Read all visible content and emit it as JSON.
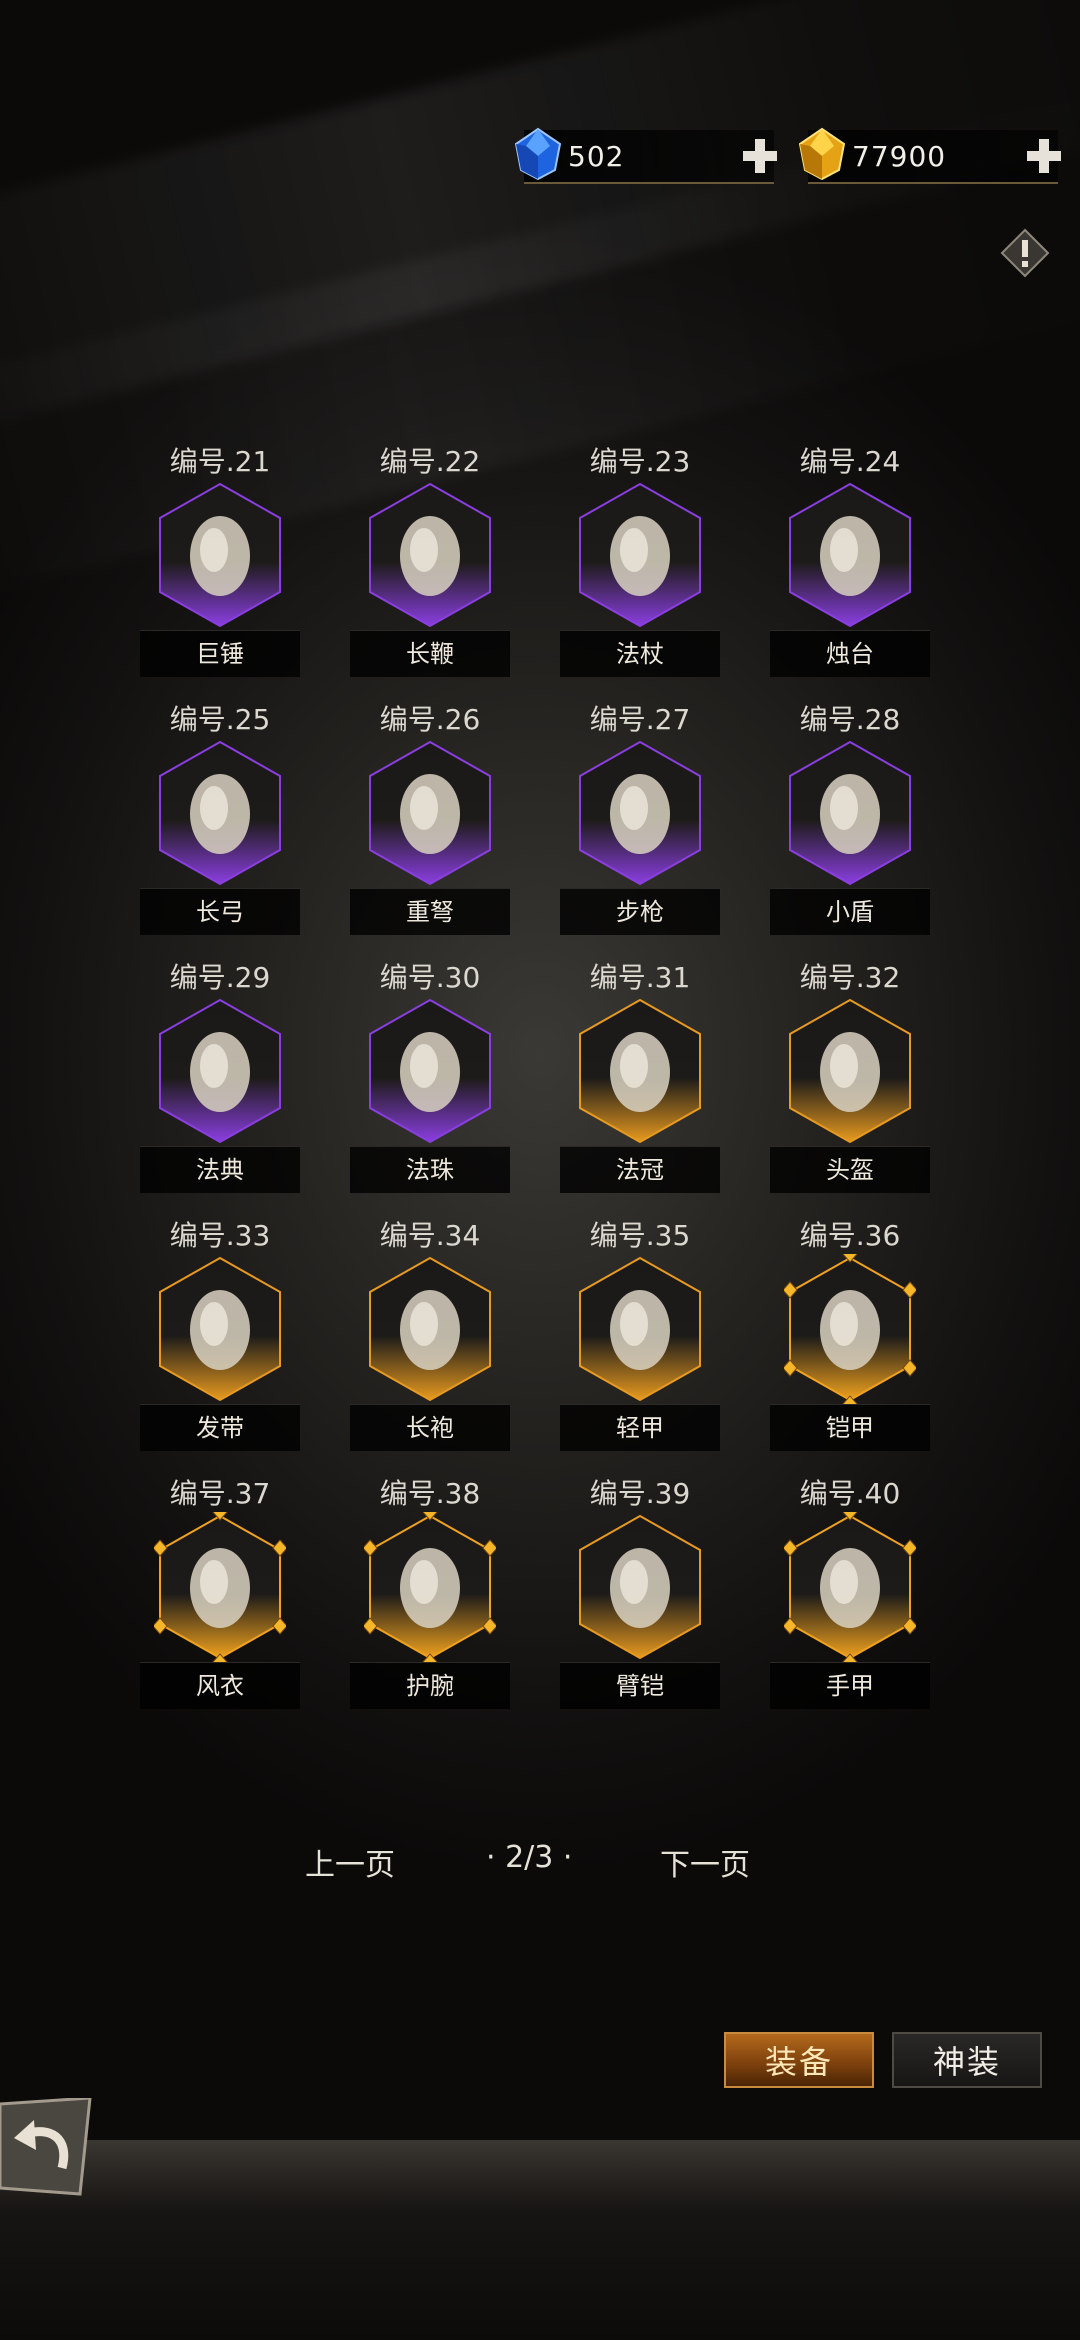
{
  "currencies": [
    {
      "name": "diamond",
      "icon": "blue-gem-icon",
      "amount": "502",
      "color": "#2f7fff"
    },
    {
      "name": "gold",
      "icon": "gold-gem-icon",
      "amount": "77900",
      "color": "#f2b51c"
    }
  ],
  "items": [
    {
      "num": "编号.21",
      "name": "巨锤",
      "icon": "warhammer-icon",
      "rarity": "epic"
    },
    {
      "num": "编号.22",
      "name": "长鞭",
      "icon": "whip-icon",
      "rarity": "epic"
    },
    {
      "num": "编号.23",
      "name": "法杖",
      "icon": "staff-icon",
      "rarity": "epic"
    },
    {
      "num": "编号.24",
      "name": "烛台",
      "icon": "candlestick-icon",
      "rarity": "epic"
    },
    {
      "num": "编号.25",
      "name": "长弓",
      "icon": "longbow-icon",
      "rarity": "epic"
    },
    {
      "num": "编号.26",
      "name": "重弩",
      "icon": "crossbow-icon",
      "rarity": "epic"
    },
    {
      "num": "编号.27",
      "name": "步枪",
      "icon": "rifle-icon",
      "rarity": "epic"
    },
    {
      "num": "编号.28",
      "name": "小盾",
      "icon": "small-shield-icon",
      "rarity": "epic"
    },
    {
      "num": "编号.29",
      "name": "法典",
      "icon": "tome-icon",
      "rarity": "epic"
    },
    {
      "num": "编号.30",
      "name": "法珠",
      "icon": "orb-icon",
      "rarity": "epic"
    },
    {
      "num": "编号.31",
      "name": "法冠",
      "icon": "wizard-hat-icon",
      "rarity": "legendary"
    },
    {
      "num": "编号.32",
      "name": "头盔",
      "icon": "helmet-icon",
      "rarity": "legendary"
    },
    {
      "num": "编号.33",
      "name": "发带",
      "icon": "headband-icon",
      "rarity": "legendary"
    },
    {
      "num": "编号.34",
      "name": "长袍",
      "icon": "robe-icon",
      "rarity": "legendary"
    },
    {
      "num": "编号.35",
      "name": "轻甲",
      "icon": "light-armor-icon",
      "rarity": "legendary"
    },
    {
      "num": "编号.36",
      "name": "铠甲",
      "icon": "plate-armor-icon",
      "rarity": "mythic"
    },
    {
      "num": "编号.37",
      "name": "风衣",
      "icon": "coat-icon",
      "rarity": "mythic"
    },
    {
      "num": "编号.38",
      "name": "护腕",
      "icon": "bracer-icon",
      "rarity": "mythic"
    },
    {
      "num": "编号.39",
      "name": "臂铠",
      "icon": "vambrace-icon",
      "rarity": "legendary"
    },
    {
      "num": "编号.40",
      "name": "手甲",
      "icon": "gauntlet-icon",
      "rarity": "mythic"
    }
  ],
  "rarity_colors": {
    "epic": "#8a3ee0",
    "legendary": "#e79a1f",
    "mythic": "#f0a21e"
  },
  "pager": {
    "prev": "上一页",
    "page": "· 2/3 ·",
    "next": "下一页"
  },
  "buttons": {
    "equip": "装备",
    "divine": "神装"
  }
}
